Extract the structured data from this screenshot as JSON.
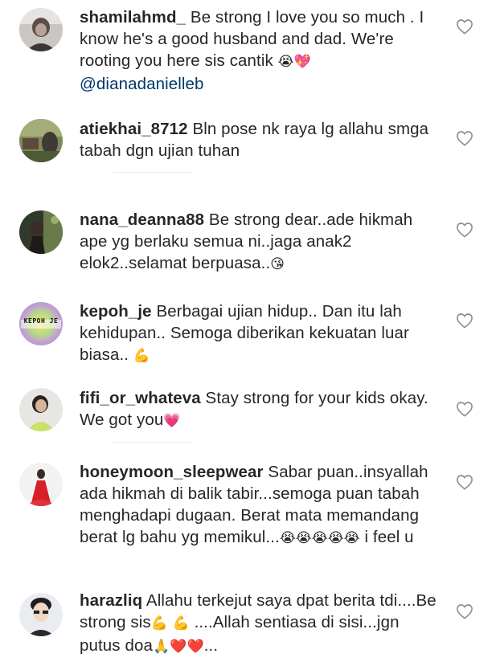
{
  "comments": [
    {
      "username": "shamilahmd_",
      "text": " Be strong I love you so much . I know he's a good husband and dad. We're rooting you here sis cantik ",
      "emoji": "😭💖",
      "mention": "@dianadanielleb"
    },
    {
      "username": "atiekhai_8712",
      "text": " Bln pose nk raya lg allahu smga tabah dgn ujian tuhan",
      "emoji": "",
      "mention": ""
    },
    {
      "username": "nana_deanna88",
      "text": " Be strong dear..ade hikmah ape yg berlaku semua ni..jaga anak2 elok2..selamat berpuasa..",
      "emoji": "😘",
      "mention": ""
    },
    {
      "username": "kepoh_je",
      "text": " Berbagai ujian hidup.. Dan itu lah kehidupan.. Semoga diberikan kekuatan luar biasa.. ",
      "emoji": "💪",
      "mention": "",
      "avatar_label": "KEPOH JE"
    },
    {
      "username": "fifi_or_whateva",
      "text": " Stay strong for your kids okay. We got you",
      "emoji": "💗",
      "mention": ""
    },
    {
      "username": "honeymoon_sleepwear",
      "text": " Sabar puan..insyallah ada hikmah di balik tabir...semoga puan tabah menghadapi dugaan. Berat mata memandang berat lg bahu yg memikul...",
      "emoji": "😭😭😭😭😭",
      "text_after": " i feel u",
      "mention": ""
    },
    {
      "username": "harazliq",
      "text": " Allahu terkejut saya dpat berita tdi....Be strong sis",
      "emoji": "💪 💪",
      "text_after": " ....Allah sentiasa di sisi...jgn putus doa",
      "emoji_after": "🙏❤️❤️",
      "text_end": "...",
      "mention": ""
    }
  ],
  "colors": {
    "text": "#262626",
    "mention": "#00376b",
    "heart_outline": "#8e8e8e"
  }
}
